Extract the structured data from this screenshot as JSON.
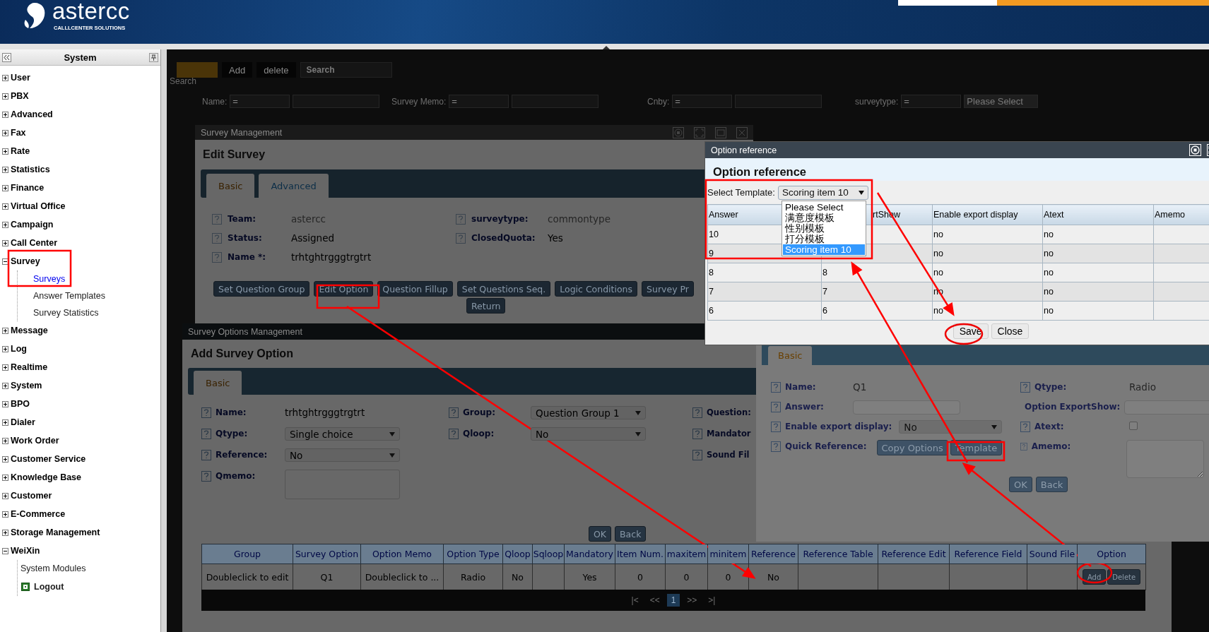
{
  "header": {
    "logo_text": "astercc",
    "logo_tagline": "CALLLCENTER SOLUTIONS"
  },
  "sidebar": {
    "title": "System",
    "items": [
      {
        "label": "User",
        "expanded": false
      },
      {
        "label": "PBX",
        "expanded": false
      },
      {
        "label": "Advanced",
        "expanded": false
      },
      {
        "label": "Fax",
        "expanded": false
      },
      {
        "label": "Rate",
        "expanded": false
      },
      {
        "label": "Statistics",
        "expanded": false
      },
      {
        "label": "Finance",
        "expanded": false
      },
      {
        "label": "Virtual Office",
        "expanded": false
      },
      {
        "label": "Campaign",
        "expanded": false
      },
      {
        "label": "Call Center",
        "expanded": false
      },
      {
        "label": "Survey",
        "expanded": true,
        "children": [
          {
            "label": "Surveys",
            "kind": "page",
            "selected": true
          },
          {
            "label": "Answer Templates",
            "kind": "page",
            "selected": false
          },
          {
            "label": "Survey Statistics",
            "kind": "page",
            "selected": false
          }
        ]
      },
      {
        "label": "Message",
        "expanded": false
      },
      {
        "label": "Log",
        "expanded": false
      },
      {
        "label": "Realtime",
        "expanded": false
      },
      {
        "label": "System",
        "expanded": false
      },
      {
        "label": "BPO",
        "expanded": false
      },
      {
        "label": "Dialer",
        "expanded": false
      },
      {
        "label": "Work Order",
        "expanded": false
      },
      {
        "label": "Customer Service",
        "expanded": false
      },
      {
        "label": "Knowledge Base",
        "expanded": false
      },
      {
        "label": "Customer",
        "expanded": false
      },
      {
        "label": "E-Commerce",
        "expanded": false
      },
      {
        "label": "Storage Management",
        "expanded": false
      },
      {
        "label": "WeiXin",
        "expanded": true,
        "children": [
          {
            "label": "System Modules",
            "kind": "module",
            "selected": false
          },
          {
            "label": "Logout",
            "kind": "logout",
            "selected": false
          }
        ]
      }
    ]
  },
  "background_page": {
    "toolbar": [
      "Add",
      "delete"
    ],
    "search_select": "Search",
    "search_label": "Search",
    "filters": [
      {
        "label": "Name:",
        "operator": "="
      },
      {
        "label": "Survey Memo:",
        "operator": "="
      },
      {
        "label": "Cnby:",
        "operator": "="
      },
      {
        "label": "surveytype:",
        "operator": "="
      }
    ],
    "surveytype_value": "Please Select"
  },
  "survey_management": {
    "title": "Survey Management",
    "heading": "Edit Survey",
    "tabs": [
      {
        "label": "Basic",
        "selected": true
      },
      {
        "label": "Advanced",
        "selected": false
      }
    ],
    "fields": [
      {
        "label": "Team:",
        "value": "astercc",
        "disabled": true
      },
      {
        "label": "surveytype:",
        "value": "commontype",
        "disabled": true
      },
      {
        "label": "Status:",
        "value": "Assigned",
        "disabled": false
      },
      {
        "label": "ClosedQuota:",
        "value": "Yes",
        "disabled": false
      },
      {
        "label": "Name *:",
        "value": "trhtghtrgggtrgtrt",
        "disabled": false
      }
    ],
    "buttons": [
      "Set Question Group",
      "Edit Option",
      "Question Fillup",
      "Set Questions Seq.",
      "Logic Conditions",
      "Survey Pr"
    ],
    "return_button": "Return"
  },
  "survey_options": {
    "title": "Survey Options Management",
    "heading": "Add Survey Option",
    "tabs": [
      {
        "label": "Basic",
        "selected": true
      }
    ],
    "columns": [
      [
        {
          "label": "Name:",
          "kind": "text",
          "value": "trhtghtrgggtrgtrt"
        },
        {
          "label": "Qtype:",
          "kind": "select",
          "value": "Single choice"
        },
        {
          "label": "Reference:",
          "kind": "select",
          "value": "No"
        },
        {
          "label": "Qmemo:",
          "kind": "textarea"
        }
      ],
      [
        {
          "label": "Group:",
          "kind": "select",
          "value": "Question Group 1"
        },
        {
          "label": "Qloop:",
          "kind": "select",
          "value": "No"
        }
      ],
      [
        {
          "label": "Question:",
          "kind": "label"
        },
        {
          "label": "Mandator",
          "kind": "label"
        },
        {
          "label": "Sound Fil",
          "kind": "label"
        }
      ]
    ],
    "buttons": [
      "OK",
      "Back"
    ],
    "table": {
      "columns": [
        "Group",
        "Survey Option",
        "Option Memo",
        "Option Type",
        "Qloop",
        "Sqloop",
        "Mandatory",
        "Item Num.",
        "maxitem",
        "minitem",
        "Reference",
        "Reference Table",
        "Reference Edit",
        "Reference Field",
        "Sound File",
        "Option"
      ],
      "rows": [
        {
          "cells": [
            "Doubleclick to edit",
            "Q1",
            "Doubleclick to ...",
            "Radio",
            "No",
            "",
            "Yes",
            "0",
            "0",
            "0",
            "No",
            "",
            "",
            "",
            ""
          ],
          "actions": [
            "Add",
            "Delete"
          ]
        }
      ]
    },
    "pager": [
      {
        "label": "|<",
        "selected": false
      },
      {
        "label": "<<",
        "selected": false
      },
      {
        "label": "1",
        "selected": true
      },
      {
        "label": ">>",
        "selected": false
      },
      {
        "label": ">|",
        "selected": false
      }
    ]
  },
  "option_edit": {
    "tabs": [
      {
        "label": "Basic",
        "selected": true
      }
    ],
    "columns": [
      [
        {
          "label": "Name:",
          "kind": "text",
          "value": "Q1"
        },
        {
          "label": "Answer:",
          "kind": "input"
        },
        {
          "label": "Enable export display:",
          "kind": "select",
          "value": "No"
        },
        {
          "label": "Quick Reference:",
          "kind": "buttons",
          "buttons": [
            "Copy Options",
            "Template"
          ]
        }
      ],
      [
        {
          "label": "Qtype:",
          "kind": "text",
          "value": "Radio"
        },
        {
          "label": "Option ExportShow:",
          "kind": "input"
        },
        {
          "label": "Atext:",
          "kind": "checkbox",
          "checked": false
        },
        {
          "label": "Amemo:",
          "kind": "textarea"
        }
      ]
    ],
    "buttons": [
      "OK",
      "Back"
    ]
  },
  "option_reference": {
    "title": "Option reference",
    "heading": "Option reference",
    "template_label": "Select Template:",
    "template_value": "Scoring item 10",
    "template_options": [
      {
        "label": "Please Select",
        "selected": false
      },
      {
        "label": "满意度模板",
        "selected": false
      },
      {
        "label": "性别模板",
        "selected": false
      },
      {
        "label": "打分模板",
        "selected": false
      },
      {
        "label": "Scoring item 10",
        "selected": true
      }
    ],
    "table": {
      "columns": [
        "Answer",
        "rtShow",
        "Enable export display",
        "Atext",
        "Amemo"
      ],
      "rows": [
        {
          "answer": "10",
          "enable_export": "no",
          "atext": "no"
        },
        {
          "answer": "9",
          "enable_export": "no",
          "atext": "no"
        },
        {
          "answer": "8",
          "export_show": "8",
          "enable_export": "no",
          "atext": "no"
        },
        {
          "answer": "7",
          "export_show": "7",
          "enable_export": "no",
          "atext": "no"
        },
        {
          "answer": "6",
          "export_show": "6",
          "enable_export": "no",
          "atext": "no"
        }
      ]
    },
    "buttons": [
      "Save",
      "Close"
    ]
  }
}
